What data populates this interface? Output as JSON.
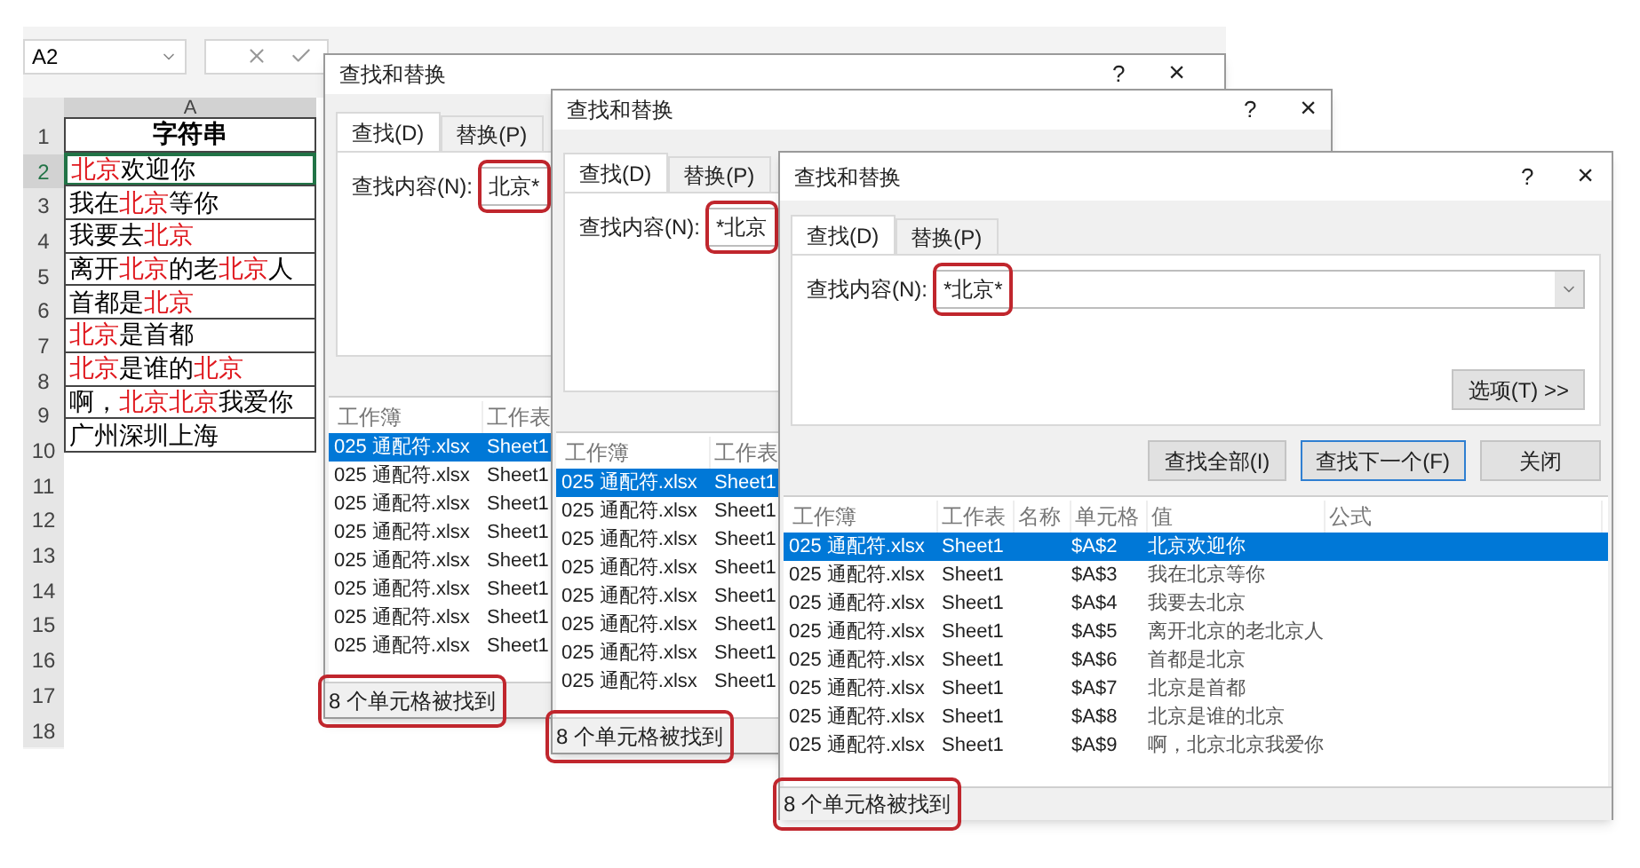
{
  "spreadsheet": {
    "name_box": "A2",
    "column_header": "A",
    "row_numbers": [
      "1",
      "2",
      "3",
      "4",
      "5",
      "6",
      "7",
      "8",
      "9",
      "10",
      "11",
      "12",
      "13",
      "14",
      "15",
      "16",
      "17",
      "18"
    ],
    "cells": [
      {
        "kind": "header",
        "selected": false,
        "segments": [
          {
            "text": "字符串",
            "red": false
          }
        ]
      },
      {
        "kind": "data",
        "selected": true,
        "segments": [
          {
            "text": "北京",
            "red": true
          },
          {
            "text": "欢迎你",
            "red": false
          }
        ]
      },
      {
        "kind": "data",
        "selected": false,
        "segments": [
          {
            "text": "我在",
            "red": false
          },
          {
            "text": "北京",
            "red": true
          },
          {
            "text": "等你",
            "red": false
          }
        ]
      },
      {
        "kind": "data",
        "selected": false,
        "segments": [
          {
            "text": "我要去",
            "red": false
          },
          {
            "text": "北京",
            "red": true
          }
        ]
      },
      {
        "kind": "data",
        "selected": false,
        "segments": [
          {
            "text": "离开",
            "red": false
          },
          {
            "text": "北京",
            "red": true
          },
          {
            "text": "的老",
            "red": false
          },
          {
            "text": "北京",
            "red": true
          },
          {
            "text": "人",
            "red": false
          }
        ]
      },
      {
        "kind": "data",
        "selected": false,
        "segments": [
          {
            "text": "首都是",
            "red": false
          },
          {
            "text": "北京",
            "red": true
          }
        ]
      },
      {
        "kind": "data",
        "selected": false,
        "segments": [
          {
            "text": "北京",
            "red": true
          },
          {
            "text": "是首都",
            "red": false
          }
        ]
      },
      {
        "kind": "data",
        "selected": false,
        "segments": [
          {
            "text": "北京",
            "red": true
          },
          {
            "text": "是谁的",
            "red": false
          },
          {
            "text": "北京",
            "red": true
          }
        ]
      },
      {
        "kind": "data",
        "selected": false,
        "segments": [
          {
            "text": "啊，",
            "red": false
          },
          {
            "text": "北京北京",
            "red": true
          },
          {
            "text": "我爱你",
            "red": false
          }
        ]
      },
      {
        "kind": "data",
        "selected": false,
        "segments": [
          {
            "text": "广州深圳上海",
            "red": false
          }
        ]
      }
    ]
  },
  "dialogs": [
    {
      "kind": "covered",
      "title": "查找和替换",
      "help": "?",
      "close": "×",
      "tabs": [
        {
          "label": "查找(D)",
          "selected": true
        },
        {
          "label": "替换(P)",
          "selected": false
        }
      ],
      "find_label": "查找内容(N):",
      "find_value": "北京*",
      "find_highlighted": true,
      "columns": [
        "工作簿",
        "工作表"
      ],
      "rows": [
        {
          "workbook": "025 通配符.xlsx",
          "sheet": "Sheet1",
          "selected": true
        },
        {
          "workbook": "025 通配符.xlsx",
          "sheet": "Sheet1",
          "selected": false
        },
        {
          "workbook": "025 通配符.xlsx",
          "sheet": "Sheet1",
          "selected": false
        },
        {
          "workbook": "025 通配符.xlsx",
          "sheet": "Sheet1",
          "selected": false
        },
        {
          "workbook": "025 通配符.xlsx",
          "sheet": "Sheet1",
          "selected": false
        },
        {
          "workbook": "025 通配符.xlsx",
          "sheet": "Sheet1",
          "selected": false
        },
        {
          "workbook": "025 通配符.xlsx",
          "sheet": "Sheet1",
          "selected": false
        },
        {
          "workbook": "025 通配符.xlsx",
          "sheet": "Sheet1",
          "selected": false
        }
      ],
      "status": "8 个单元格被找到",
      "status_highlighted": true
    },
    {
      "kind": "covered",
      "title": "查找和替换",
      "help": "?",
      "close": "×",
      "tabs": [
        {
          "label": "查找(D)",
          "selected": true
        },
        {
          "label": "替换(P)",
          "selected": false
        }
      ],
      "find_label": "查找内容(N):",
      "find_value": "*北京",
      "find_highlighted": true,
      "columns": [
        "工作簿",
        "工作表"
      ],
      "rows": [
        {
          "workbook": "025 通配符.xlsx",
          "sheet": "Sheet1",
          "selected": true
        },
        {
          "workbook": "025 通配符.xlsx",
          "sheet": "Sheet1",
          "selected": false
        },
        {
          "workbook": "025 通配符.xlsx",
          "sheet": "Sheet1",
          "selected": false
        },
        {
          "workbook": "025 通配符.xlsx",
          "sheet": "Sheet1",
          "selected": false
        },
        {
          "workbook": "025 通配符.xlsx",
          "sheet": "Sheet1",
          "selected": false
        },
        {
          "workbook": "025 通配符.xlsx",
          "sheet": "Sheet1",
          "selected": false
        },
        {
          "workbook": "025 通配符.xlsx",
          "sheet": "Sheet1",
          "selected": false
        },
        {
          "workbook": "025 通配符.xlsx",
          "sheet": "Sheet1",
          "selected": false
        }
      ],
      "status": "8 个单元格被找到",
      "status_highlighted": true
    },
    {
      "kind": "full",
      "title": "查找和替换",
      "help": "?",
      "close": "×",
      "tabs": [
        {
          "label": "查找(D)",
          "selected": true
        },
        {
          "label": "替换(P)",
          "selected": false
        }
      ],
      "find_label": "查找内容(N):",
      "find_value": "*北京*",
      "find_highlighted": true,
      "options_button": "选项(T) >>",
      "buttons": [
        {
          "label": "查找全部(I)",
          "focused": false
        },
        {
          "label": "查找下一个(F)",
          "focused": true
        },
        {
          "label": "关闭",
          "focused": false
        }
      ],
      "columns": [
        "工作簿",
        "工作表",
        "名称",
        "单元格",
        "值",
        "公式"
      ],
      "rows": [
        {
          "workbook": "025 通配符.xlsx",
          "sheet": "Sheet1",
          "cell": "$A$2",
          "value": "北京欢迎你",
          "selected": true
        },
        {
          "workbook": "025 通配符.xlsx",
          "sheet": "Sheet1",
          "cell": "$A$3",
          "value": "我在北京等你",
          "selected": false
        },
        {
          "workbook": "025 通配符.xlsx",
          "sheet": "Sheet1",
          "cell": "$A$4",
          "value": "我要去北京",
          "selected": false
        },
        {
          "workbook": "025 通配符.xlsx",
          "sheet": "Sheet1",
          "cell": "$A$5",
          "value": "离开北京的老北京人",
          "selected": false
        },
        {
          "workbook": "025 通配符.xlsx",
          "sheet": "Sheet1",
          "cell": "$A$6",
          "value": "首都是北京",
          "selected": false
        },
        {
          "workbook": "025 通配符.xlsx",
          "sheet": "Sheet1",
          "cell": "$A$7",
          "value": "北京是首都",
          "selected": false
        },
        {
          "workbook": "025 通配符.xlsx",
          "sheet": "Sheet1",
          "cell": "$A$8",
          "value": "北京是谁的北京",
          "selected": false
        },
        {
          "workbook": "025 通配符.xlsx",
          "sheet": "Sheet1",
          "cell": "$A$9",
          "value": "啊，北京北京我爱你",
          "selected": false
        }
      ],
      "status": "8 个单元格被找到",
      "status_highlighted": true
    }
  ]
}
